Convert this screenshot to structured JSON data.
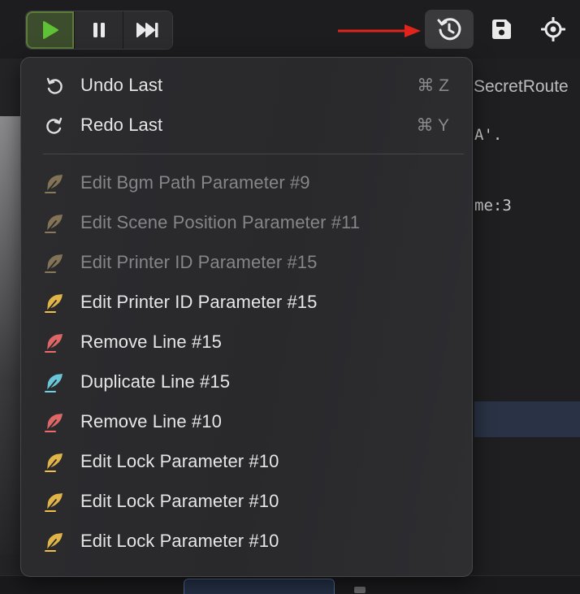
{
  "toolbar": {
    "play_icon": "play-icon",
    "pause_icon": "pause-icon",
    "skip_icon": "skip-forward-icon",
    "history_icon": "history-icon",
    "save_icon": "save-icon",
    "locate_icon": "crosshair-icon",
    "accent_play": "#5fc135"
  },
  "editor": {
    "route_text": "SecretRoute",
    "code_lines": [
      "A'.",
      "me:3"
    ]
  },
  "menu": {
    "undo": {
      "label": "Undo Last",
      "shortcut": "⌘ Z",
      "icon": "undo-icon"
    },
    "redo": {
      "label": "Redo Last",
      "shortcut": "⌘ Y",
      "icon": "redo-icon"
    },
    "history": [
      {
        "label": "Edit Bgm Path Parameter #9",
        "icon": "quill-icon",
        "color": "#8a7a5a",
        "enabled": false
      },
      {
        "label": "Edit Scene Position Parameter #11",
        "icon": "quill-icon",
        "color": "#8a7a5a",
        "enabled": false
      },
      {
        "label": "Edit Printer ID Parameter #15",
        "icon": "quill-icon",
        "color": "#8a7a5a",
        "enabled": false
      },
      {
        "label": "Edit Printer ID Parameter #15",
        "icon": "quill-icon",
        "color": "#f0c04a",
        "enabled": true
      },
      {
        "label": "Remove Line #15",
        "icon": "quill-icon",
        "color": "#ef6b6b",
        "enabled": true
      },
      {
        "label": "Duplicate Line #15",
        "icon": "quill-icon",
        "color": "#6fd3e6",
        "enabled": true
      },
      {
        "label": "Remove Line #10",
        "icon": "quill-icon",
        "color": "#ef6b6b",
        "enabled": true
      },
      {
        "label": "Edit Lock Parameter #10",
        "icon": "quill-icon",
        "color": "#f0c04a",
        "enabled": true
      },
      {
        "label": "Edit Lock Parameter #10",
        "icon": "quill-icon",
        "color": "#f0c04a",
        "enabled": true
      },
      {
        "label": "Edit Lock Parameter #10",
        "icon": "quill-icon",
        "color": "#f0c04a",
        "enabled": true
      }
    ]
  }
}
